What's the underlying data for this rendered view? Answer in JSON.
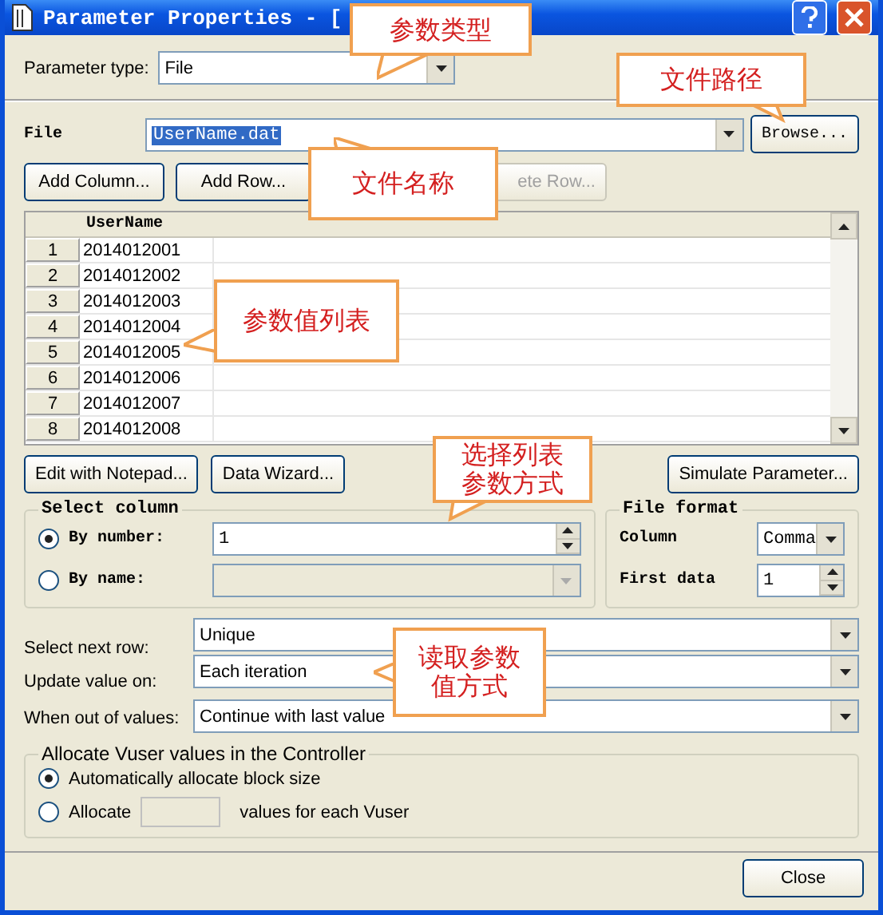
{
  "window": {
    "title": "Parameter Properties - ["
  },
  "parameter_type": {
    "label": "Parameter type:",
    "value": "File"
  },
  "file": {
    "label": "File",
    "value": "UserName.dat",
    "browse": "Browse..."
  },
  "grid_buttons": [
    {
      "label": "Add Column...",
      "disabled": false
    },
    {
      "label": "Add Row...",
      "disabled": false
    },
    {
      "label": "ete Row...",
      "disabled": true
    }
  ],
  "table": {
    "columns": [
      "UserName"
    ],
    "rows": [
      {
        "number": "1",
        "value": "2014012001"
      },
      {
        "number": "2",
        "value": "2014012002"
      },
      {
        "number": "3",
        "value": "2014012003"
      },
      {
        "number": "4",
        "value": "2014012004"
      },
      {
        "number": "5",
        "value": "2014012005"
      },
      {
        "number": "6",
        "value": "2014012006"
      },
      {
        "number": "7",
        "value": "2014012007"
      },
      {
        "number": "8",
        "value": "2014012008"
      }
    ]
  },
  "tool_buttons": [
    "Edit with Notepad...",
    "Data Wizard...",
    "Simulate Parameter..."
  ],
  "select_column": {
    "title": "Select column",
    "options": [
      {
        "label": "By number:",
        "selected": true,
        "value": "1"
      },
      {
        "label": "By name:",
        "selected": false
      }
    ]
  },
  "file_format": {
    "title": "File format",
    "column_label": "Column",
    "column_value": "Comma",
    "first_data_label": "First data",
    "first_data_value": "1"
  },
  "settings": [
    {
      "label": "Select next row:",
      "value": "Unique"
    },
    {
      "label": "Update value on:",
      "value": "Each iteration"
    },
    {
      "label": "When out of values:",
      "value": "Continue with last value"
    }
  ],
  "allocate": {
    "title": "Allocate Vuser values in the Controller",
    "options": [
      {
        "label": "Automatically allocate block size",
        "selected": true
      },
      {
        "label": "Allocate",
        "suffix": "values for each Vuser",
        "selected": false
      }
    ]
  },
  "buttons": [
    "Close"
  ],
  "annotations": [
    {
      "text": "参数类型"
    },
    {
      "text": "文件路径"
    },
    {
      "text": "文件名称"
    },
    {
      "text": "参数值列表"
    },
    {
      "text": "选择列表参数方式"
    },
    {
      "text": "读取参数值方式"
    }
  ]
}
